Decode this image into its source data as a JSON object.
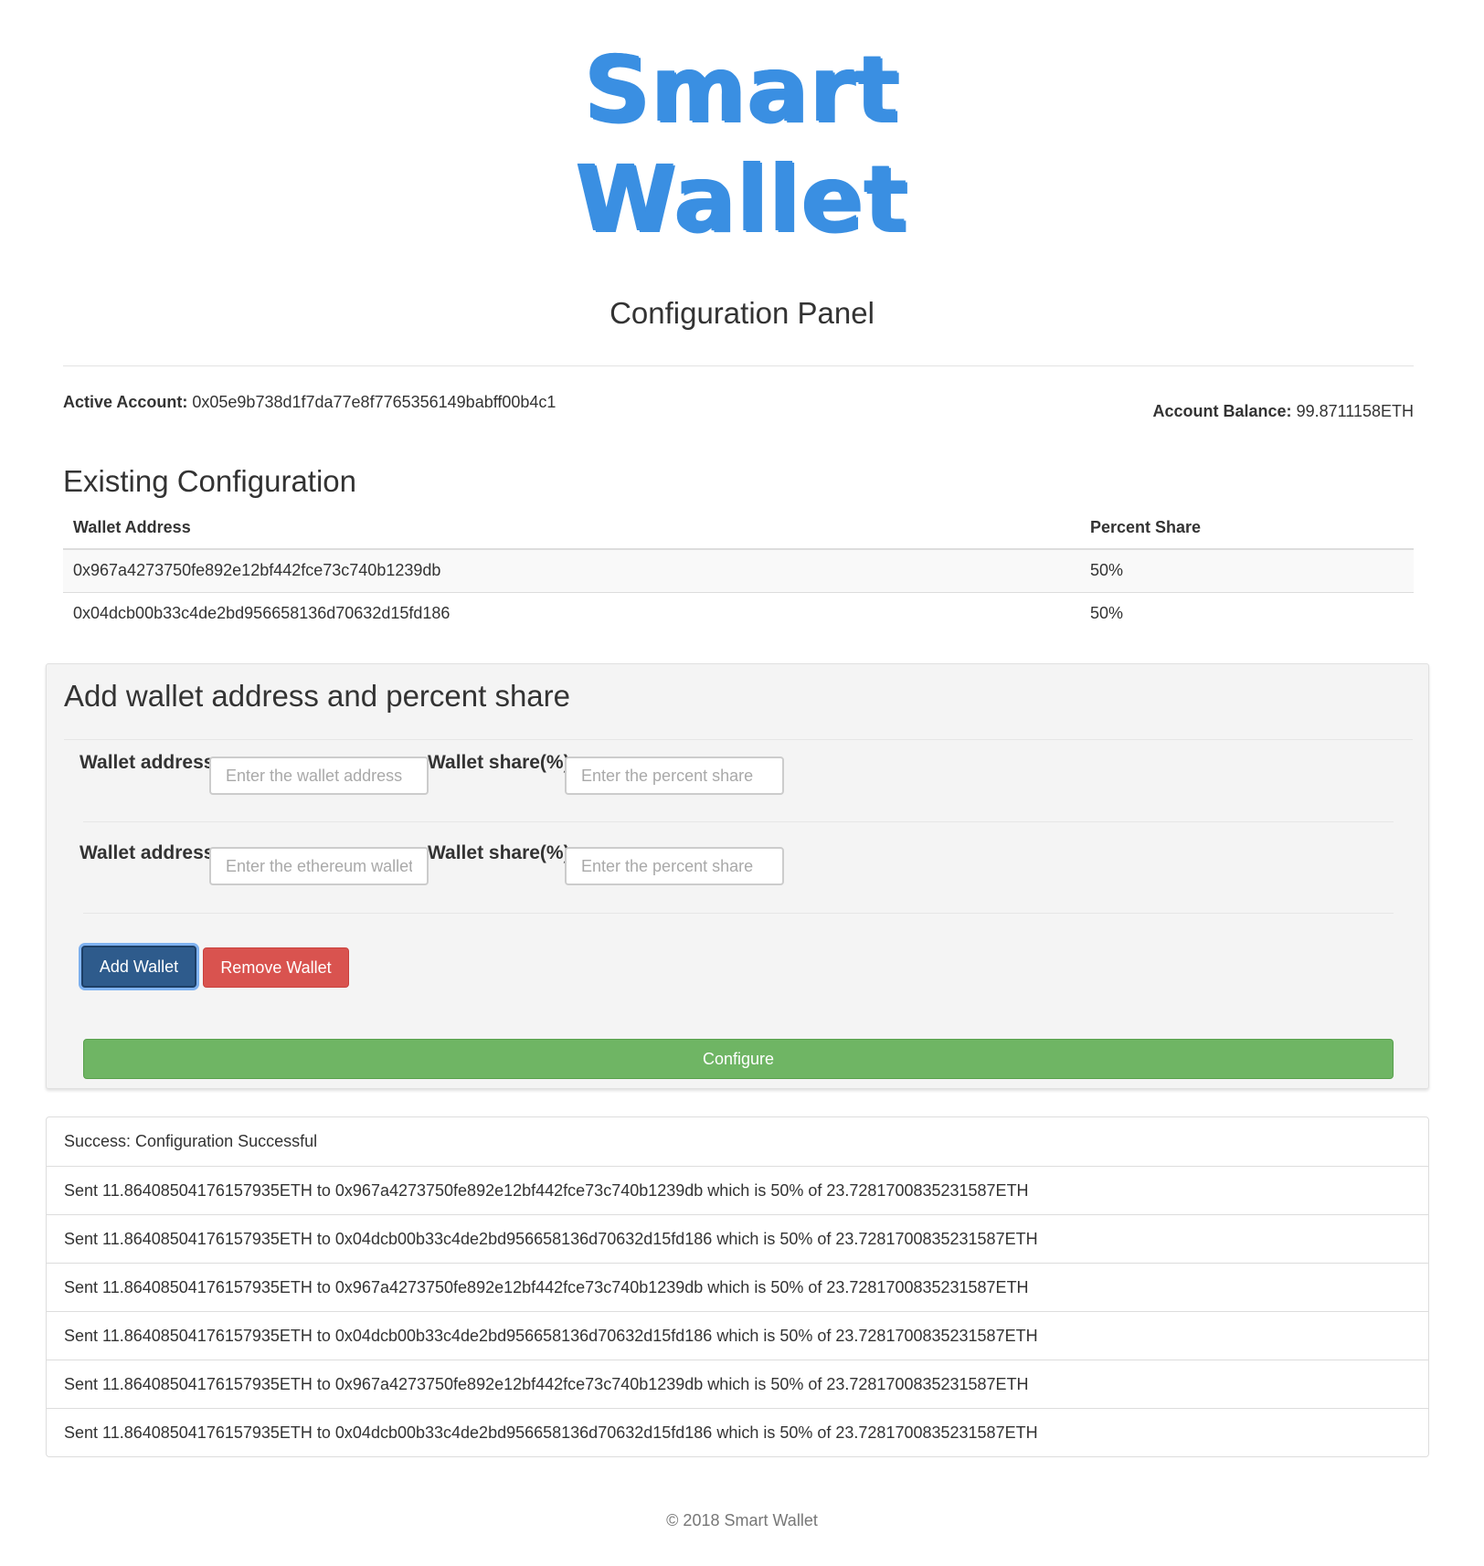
{
  "logo": {
    "line1": "Smart",
    "line2": "Wallet"
  },
  "panel_title": "Configuration Panel",
  "account": {
    "active_label": "Active Account:",
    "active_value": "0x05e9b738d1f7da77e8f7765356149babff00b4c1",
    "balance_label": "Account Balance:",
    "balance_value": "99.8711158ETH"
  },
  "existing": {
    "title": "Existing Configuration",
    "headers": [
      "Wallet Address",
      "Percent Share"
    ],
    "rows": [
      [
        "0x967a4273750fe892e12bf442fce73c740b1239db",
        "50%"
      ],
      [
        "0x04dcb00b33c4de2bd956658136d70632d15fd186",
        "50%"
      ]
    ]
  },
  "add_panel": {
    "title": "Add wallet address and percent share",
    "rows": [
      {
        "address_label": "Wallet address",
        "address_placeholder": "Enter the wallet address",
        "share_label": "Wallet share(%)",
        "share_placeholder": "Enter the percent share"
      },
      {
        "address_label": "Wallet address",
        "address_placeholder": "Enter the ethereum wallet address",
        "share_label": "Wallet share(%)",
        "share_placeholder": "Enter the percent share"
      }
    ],
    "add_button": "Add Wallet",
    "remove_button": "Remove Wallet",
    "configure_button": "Configure"
  },
  "log": [
    "Success: Configuration Successful",
    "Sent 11.86408504176157935ETH to 0x967a4273750fe892e12bf442fce73c740b1239db which is 50% of 23.7281700835231587ETH",
    "Sent 11.86408504176157935ETH to 0x04dcb00b33c4de2bd956658136d70632d15fd186 which is 50% of 23.7281700835231587ETH",
    "Sent 11.86408504176157935ETH to 0x967a4273750fe892e12bf442fce73c740b1239db which is 50% of 23.7281700835231587ETH",
    "Sent 11.86408504176157935ETH to 0x04dcb00b33c4de2bd956658136d70632d15fd186 which is 50% of 23.7281700835231587ETH",
    "Sent 11.86408504176157935ETH to 0x967a4273750fe892e12bf442fce73c740b1239db which is 50% of 23.7281700835231587ETH",
    "Sent 11.86408504176157935ETH to 0x04dcb00b33c4de2bd956658136d70632d15fd186 which is 50% of 23.7281700835231587ETH"
  ],
  "footer": "© 2018 Smart Wallet",
  "colors": {
    "brand": "#3a8fe2",
    "primary_button": "#2e5b8c",
    "danger_button": "#d9534f",
    "success_button": "#6fb564"
  }
}
